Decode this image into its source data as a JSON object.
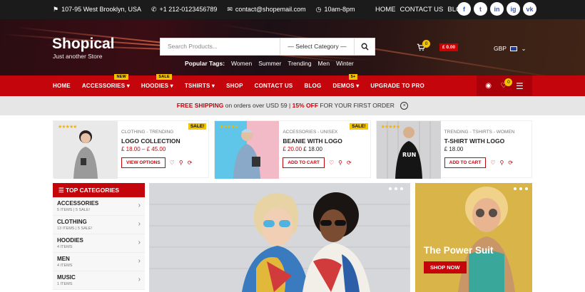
{
  "topbar": {
    "address": "107-95 West Brooklyn, USA",
    "phone": "+1 212-0123456789",
    "email": "contact@shopemail.com",
    "hours": "10am-8pm",
    "links": [
      "HOME",
      "CONTACT US",
      "BLOG"
    ],
    "social": [
      "f",
      "t",
      "in",
      "ig",
      "vk"
    ]
  },
  "header": {
    "logo": "Shopical",
    "tagline": "Just another Store",
    "search_placeholder": "Search Products...",
    "category": "— Select Category —",
    "popular_label": "Popular Tags:",
    "popular_tags": [
      "Women",
      "Summer",
      "Trending",
      "Men",
      "Winter"
    ],
    "cart_count": "0",
    "cart_total": "£ 0.00",
    "currency": "GBP"
  },
  "nav": {
    "items": [
      {
        "label": "HOME",
        "tag": ""
      },
      {
        "label": "ACCESSORIES",
        "tag": "NEW"
      },
      {
        "label": "HOODIES",
        "tag": "SALE"
      },
      {
        "label": "TSHIRTS",
        "tag": ""
      },
      {
        "label": "SHOP",
        "tag": ""
      },
      {
        "label": "CONTACT US",
        "tag": ""
      },
      {
        "label": "BLOG",
        "tag": ""
      },
      {
        "label": "DEMOS",
        "tag": "5+"
      },
      {
        "label": "UPGRADE TO PRO",
        "tag": ""
      }
    ],
    "wishlist_count": "0"
  },
  "promo": {
    "shipping": "FREE SHIPPING",
    "shipping_rest": "on orders over USD 59",
    "sep": "|",
    "discount": "15% OFF",
    "discount_rest": "FOR YOUR FIRST ORDER"
  },
  "products": [
    {
      "meta": "CLOTHING - TRENDING",
      "title": "LOGO COLLECTION",
      "price": "£ 18.00 – £ 45.00",
      "action": "VIEW OPTIONS",
      "sale": "SALE!"
    },
    {
      "meta": "ACCESSORIES - UNISEX",
      "title": "BEANIE WITH LOGO",
      "price_old": "£ 20.00",
      "price_new": "£ 18.00",
      "action": "ADD TO CART",
      "sale": "SALE!"
    },
    {
      "meta": "TRENDING - TSHIRTS - WOMEN",
      "title": "T-SHIRT WITH LOGO",
      "price_new": "£ 18.00",
      "action": "ADD TO CART",
      "sale": ""
    }
  ],
  "sidebar": {
    "title": "TOP CATEGORIES",
    "rows": [
      {
        "name": "ACCESSORIES",
        "sub": "5 ITEMS | 5 SALE!"
      },
      {
        "name": "CLOTHING",
        "sub": "13 ITEMS | 5 SALE!"
      },
      {
        "name": "HOODIES",
        "sub": "4 ITEMS"
      },
      {
        "name": "MEN",
        "sub": "4 ITEMS"
      },
      {
        "name": "MUSIC",
        "sub": "1 ITEMS"
      }
    ]
  },
  "banner": {
    "title": "The Power Suit",
    "cta": "SHOP NOW"
  },
  "colors": {
    "brand_red": "#c4050c",
    "accent_yellow": "#f5c400"
  }
}
